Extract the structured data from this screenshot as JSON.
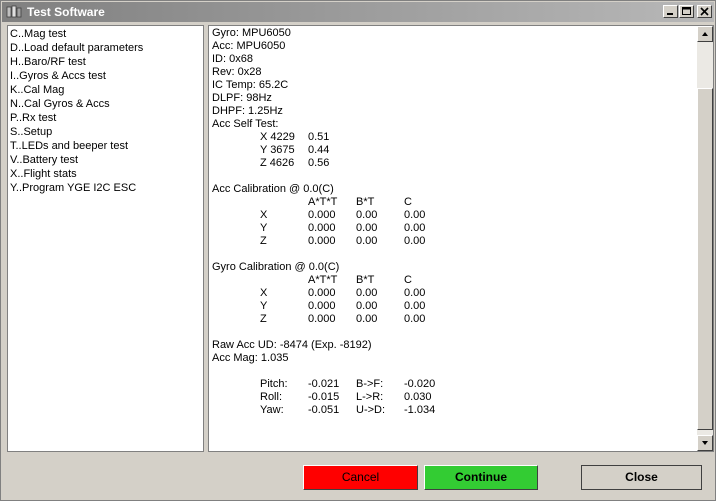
{
  "window": {
    "title": "Test Software"
  },
  "menu": {
    "items": [
      "C..Mag test",
      "D..Load default parameters",
      "H..Baro/RF test",
      "I..Gyros & Accs test",
      "K..Cal Mag",
      "N..Cal Gyros & Accs",
      "P..Rx test",
      "S..Setup",
      "T..LEDs and beeper test",
      "V..Battery test",
      "X..Flight stats",
      "Y..Program YGE I2C ESC"
    ]
  },
  "output": {
    "header_lines": [
      "Gyro: MPU6050",
      "Acc: MPU6050",
      "ID: 0x68",
      "Rev: 0x28",
      "IC Temp: 65.2C",
      "DLPF: 98Hz",
      "DHPF: 1.25Hz",
      "Acc Self Test:"
    ],
    "self_test": [
      {
        "axis": "X 4229",
        "value": "0.51"
      },
      {
        "axis": "Y 3675",
        "value": "0.44"
      },
      {
        "axis": "Z 4626",
        "value": "0.56"
      }
    ],
    "acc_cal": {
      "title": "Acc Calibration @ 0.0(C)",
      "columns": [
        "A*T*T",
        "B*T",
        "C"
      ],
      "rows": [
        {
          "axis": "X",
          "a": "0.000",
          "b": "0.00",
          "c": "0.00"
        },
        {
          "axis": "Y",
          "a": "0.000",
          "b": "0.00",
          "c": "0.00"
        },
        {
          "axis": "Z",
          "a": "0.000",
          "b": "0.00",
          "c": "0.00"
        }
      ]
    },
    "gyro_cal": {
      "title": "Gyro Calibration @ 0.0(C)",
      "columns": [
        "A*T*T",
        "B*T",
        "C"
      ],
      "rows": [
        {
          "axis": "X",
          "a": "0.000",
          "b": "0.00",
          "c": "0.00"
        },
        {
          "axis": "Y",
          "a": "0.000",
          "b": "0.00",
          "c": "0.00"
        },
        {
          "axis": "Z",
          "a": "0.000",
          "b": "0.00",
          "c": "0.00"
        }
      ]
    },
    "raw_acc": "Raw Acc UD: -8474 (Exp. -8192)",
    "acc_mag": "Acc Mag: 1.035",
    "attitude": [
      {
        "label": "Pitch:",
        "value": "-0.021",
        "label2": "B->F:",
        "value2": "-0.020"
      },
      {
        "label": "Roll:",
        "value": "-0.015",
        "label2": "L->R:",
        "value2": "0.030"
      },
      {
        "label": "Yaw:",
        "value": "-0.051",
        "label2": "U->D:",
        "value2": "-1.034"
      }
    ]
  },
  "buttons": {
    "cancel": "Cancel",
    "continue": "Continue",
    "close": "Close"
  }
}
